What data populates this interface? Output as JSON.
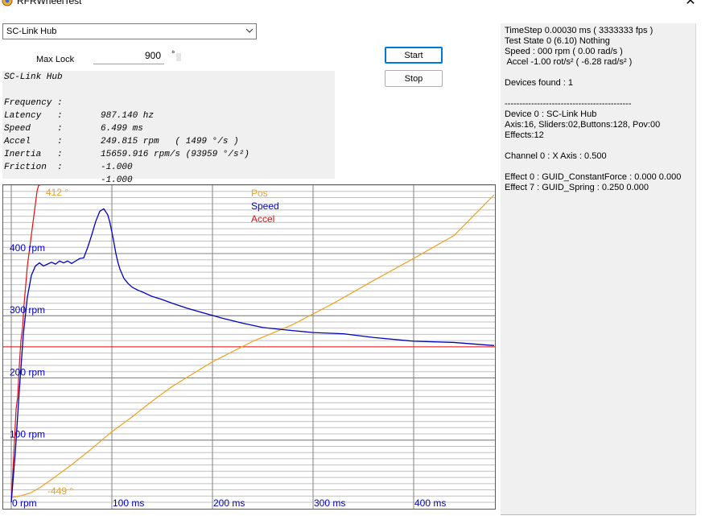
{
  "window": {
    "title": "RFRWheelTest",
    "close_glyph": "✕"
  },
  "device_select": {
    "value": "SC-Link Hub"
  },
  "max_lock": {
    "label": "Max Lock",
    "value": "900",
    "unit": "°"
  },
  "buttons": {
    "start": "Start",
    "stop": "Stop"
  },
  "readout": {
    "header": "SC-Link Hub",
    "rows": [
      {
        "key": "Frequency :",
        "value": "987.140 hz"
      },
      {
        "key": "Latency   :",
        "value": "6.499 ms"
      },
      {
        "key": "Speed     :",
        "value": "249.815 rpm   ( 1499 °/s )"
      },
      {
        "key": "Accel     :",
        "value": "15659.916 rpm/s (93959 °/s²)"
      },
      {
        "key": "Inertia   :",
        "value": "-1.000"
      },
      {
        "key": "Friction  :",
        "value": "-1.000"
      }
    ]
  },
  "info_panel": [
    "TimeStep 0.00030 ms ( 3333333 fps )",
    "Test State 0 (6.10) Nothing",
    "Speed : 000 rpm ( 0.00 rad/s )",
    " Accel -1.00 rot/s² ( -6.28 rad/s² )",
    "",
    "Devices found : 1",
    "",
    "-------------------------------------------",
    "Device 0 : SC-Link Hub",
    "Axis:16, Sliders:02,Buttons:128, Pov:00",
    "Effects:12",
    "",
    "Channel 0 : X Axis : 0.500",
    "",
    "Effect 0 : GUID_ConstantForce : 0.000 0.000",
    "Effect 7 : GUID_Spring : 0.250 0.000"
  ],
  "chart_data": {
    "type": "line",
    "colors": {
      "pos": "#f0a020",
      "speed": "#0000c0",
      "accel": "#e01010",
      "grid": "#c0c0c0",
      "grid_major": "#808080"
    },
    "legend": [
      "Pos",
      "Speed",
      "Accel"
    ],
    "x_tick_labels": [
      "0 rpm",
      "100 ms",
      "200 ms",
      "300 ms",
      "400 ms"
    ],
    "x_ticks": [
      0,
      100,
      200,
      300,
      400
    ],
    "y_tick_labels": [
      "100 rpm",
      "200 rpm",
      "300 rpm",
      "400 rpm"
    ],
    "y_ticks": [
      100,
      200,
      300,
      400
    ],
    "xlim": [
      0,
      480
    ],
    "ylim": [
      0,
      510
    ],
    "pos_labels": {
      "top": "412 °",
      "bottom": "-449 °"
    },
    "series": [
      {
        "name": "Speed",
        "x": [
          0,
          2,
          4,
          6,
          8,
          12,
          16,
          20,
          24,
          28,
          32,
          36,
          40,
          44,
          48,
          52,
          56,
          60,
          64,
          68,
          72,
          76,
          80,
          84,
          88,
          92,
          96,
          98,
          100,
          102,
          104,
          106,
          108,
          112,
          116,
          120,
          126,
          132,
          140,
          150,
          160,
          175,
          190,
          210,
          230,
          250,
          280,
          300,
          330,
          360,
          400,
          440,
          480
        ],
        "y": [
          0,
          40,
          80,
          130,
          180,
          270,
          330,
          365,
          380,
          385,
          380,
          383,
          386,
          383,
          388,
          385,
          388,
          384,
          388,
          392,
          393,
          410,
          430,
          452,
          468,
          472,
          462,
          450,
          435,
          418,
          400,
          386,
          375,
          360,
          352,
          346,
          341,
          337,
          331,
          326,
          320,
          312,
          305,
          296,
          288,
          281,
          276,
          273,
          271,
          265,
          259,
          257,
          252
        ]
      },
      {
        "name": "Pos",
        "x": [
          0,
          10,
          20,
          30,
          40,
          60,
          80,
          100,
          120,
          140,
          160,
          200,
          240,
          280,
          320,
          360,
          400,
          440,
          480
        ],
        "y": [
          -449,
          -444,
          -435,
          -418,
          -398,
          -356,
          -310,
          -262,
          -220,
          -175,
          -133,
          -63,
          -5,
          43,
          103,
          168,
          231,
          296,
          412
        ]
      },
      {
        "name": "Accel",
        "x": [
          0,
          2,
          4,
          6,
          8,
          10,
          12,
          14,
          16,
          18,
          20,
          22,
          24,
          26,
          28,
          30,
          32,
          34,
          36,
          480
        ],
        "y": [
          0,
          50,
          100,
          150,
          170,
          220,
          260,
          280,
          320,
          350,
          380,
          400,
          420,
          440,
          460,
          480,
          500,
          510,
          510,
          250
        ]
      }
    ]
  }
}
